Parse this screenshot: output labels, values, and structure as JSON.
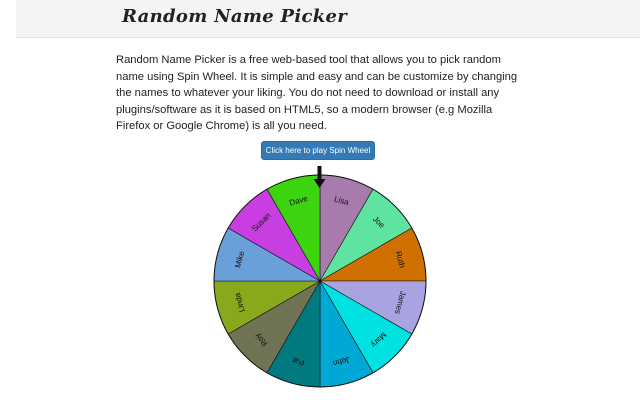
{
  "header": {
    "title": "Random Name Picker"
  },
  "main": {
    "description": "Random Name Picker is a free web-based tool that allows you to pick random name using Spin Wheel. It is simple and easy and can be customize by changing the names to whatever your liking. You do not need to download or install any plugins/software as it is based on HTML5, so a modern browser (e.g Mozilla Firefox or Google Chrome) is all you need.",
    "play_button_label": "Click here to play Spin Wheel"
  },
  "wheel": {
    "pointer_icon": "down-arrow-icon",
    "segments": [
      {
        "name": "Lisa",
        "color": "#a77bab"
      },
      {
        "name": "Joe",
        "color": "#5fe3a1"
      },
      {
        "name": "Ruth",
        "color": "#d07000"
      },
      {
        "name": "James",
        "color": "#a9a3e1"
      },
      {
        "name": "Mary",
        "color": "#00e1e1"
      },
      {
        "name": "John",
        "color": "#00a8d6"
      },
      {
        "name": "Pat",
        "color": "#007a80"
      },
      {
        "name": "Roy",
        "color": "#717355"
      },
      {
        "name": "Linda",
        "color": "#8aa81c"
      },
      {
        "name": "Mike",
        "color": "#6aa0d9"
      },
      {
        "name": "Susan",
        "color": "#c93ee0"
      },
      {
        "name": "Dave",
        "color": "#3cd40e"
      }
    ]
  }
}
